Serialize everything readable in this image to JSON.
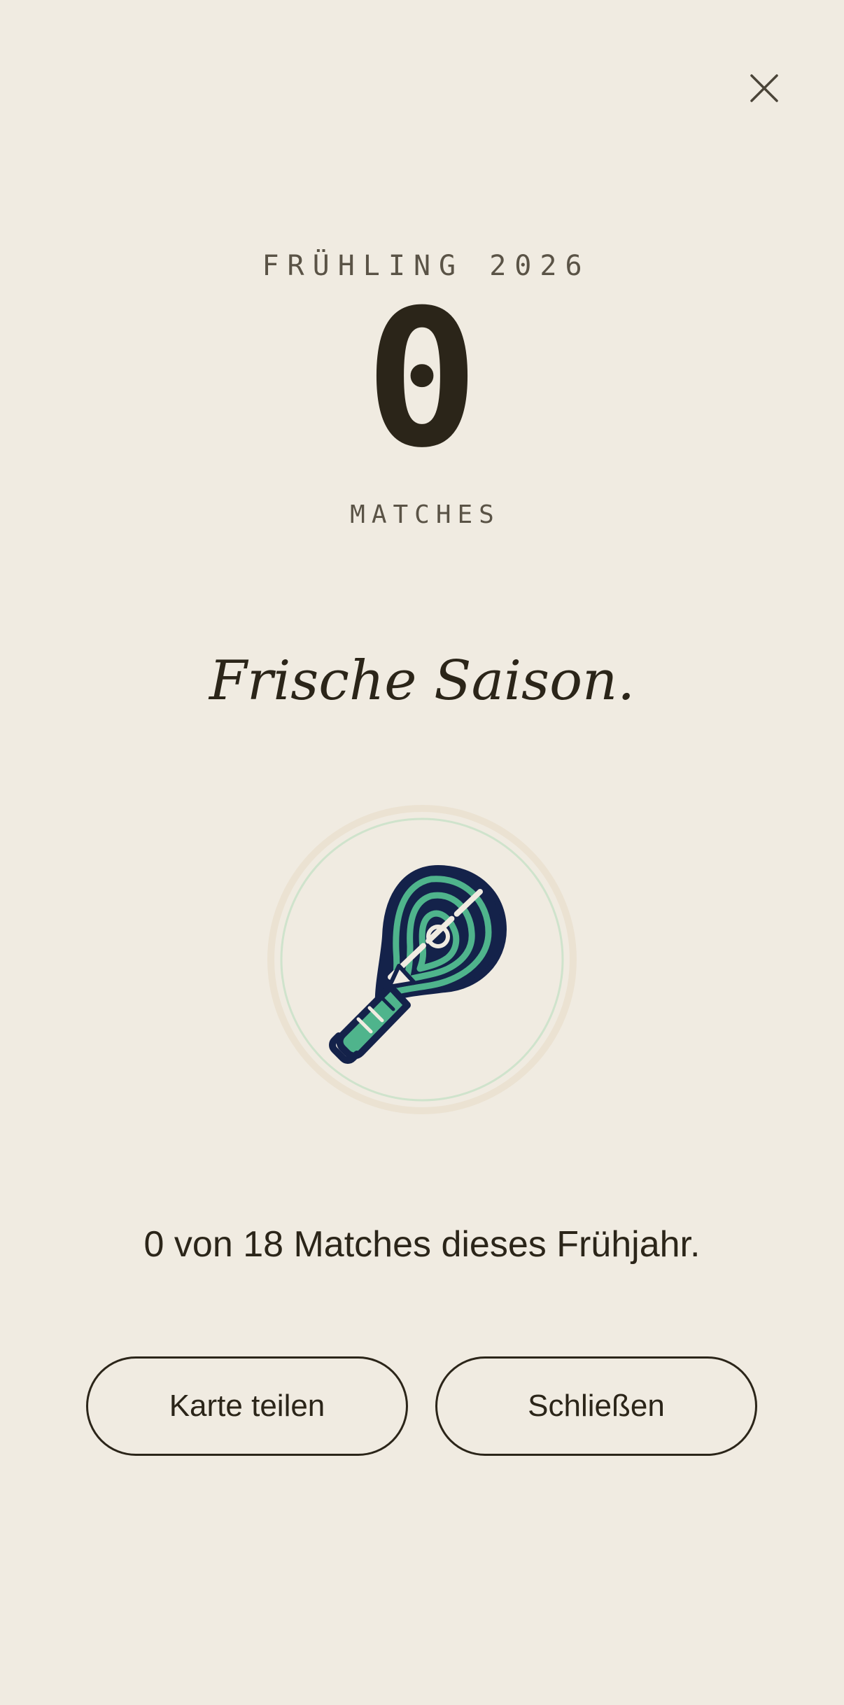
{
  "header": {
    "close_icon": "close-icon"
  },
  "season": {
    "label": "FRÜHLING 2026"
  },
  "stats": {
    "count": "0",
    "count_label": "MATCHES"
  },
  "headline": "Frische Saison.",
  "badge": {
    "icon": "padel-racket-icon",
    "colors": {
      "outer_ring": "#ebe2d2",
      "inner_ring": "#cfe3cc",
      "racket_fill": "#14224a",
      "racket_accent": "#4fb48c",
      "racket_stripe": "#f0ebe1"
    }
  },
  "summary": "0 von 18 Matches dieses Frühjahr.",
  "actions": {
    "share_label": "Karte teilen",
    "close_label": "Schließen"
  },
  "colors": {
    "background": "#f0ebe1",
    "text": "#2b2519",
    "muted_text": "#5a5346"
  }
}
